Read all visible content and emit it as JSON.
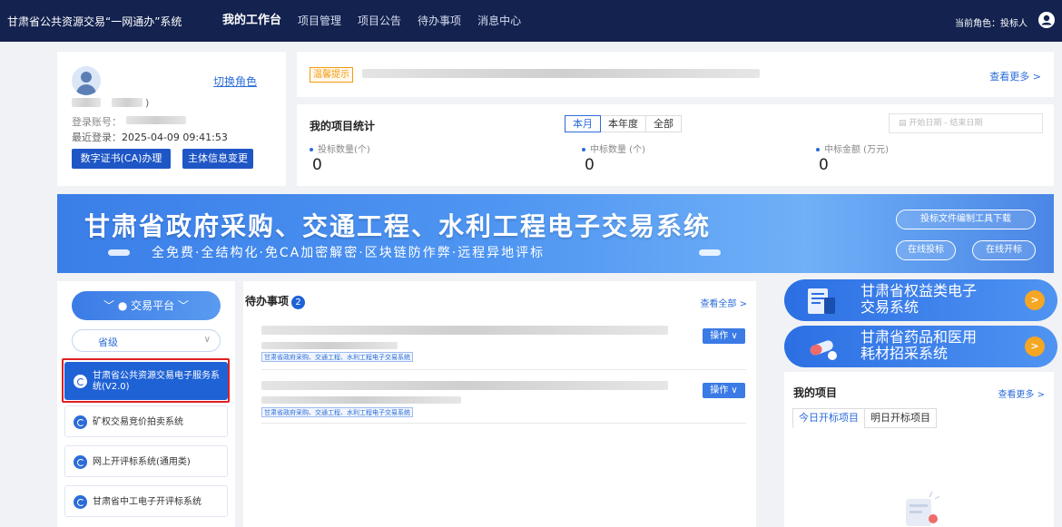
{
  "topbar": {
    "title": "甘肃省公共资源交易“一网通办”系统",
    "nav": [
      "我的工作台",
      "项目管理",
      "项目公告",
      "待办事项",
      "消息中心"
    ],
    "role": "当前角色：投标人"
  },
  "profile": {
    "switch_role": "切换角色",
    "name_suffix": ")",
    "login_account_label": "登录账号：",
    "last_login_label": "最近登录：",
    "last_login_value": "2025-04-09 09:41:53",
    "ca_button": "数字证书(CA)办理",
    "entity_button": "主体信息变更"
  },
  "notice": {
    "tag": "温馨提示",
    "more": "查看更多 >"
  },
  "stats": {
    "title": "我的项目统计",
    "tabs": [
      "本月",
      "本年度",
      "全部"
    ],
    "date_range": "开始日期 - 结束日期",
    "items": [
      {
        "label": "投标数量(个)",
        "value": "0"
      },
      {
        "label": "中标数量 (个)",
        "value": "0"
      },
      {
        "label": "中标金额 (万元)",
        "value": "0"
      }
    ]
  },
  "banner": {
    "title": "甘肃省政府采购、交通工程、水利工程电子交易系统",
    "subtitle": "全免费·全结构化·免CA加密解密·区块链防作弊·远程异地评标",
    "btn_download": "投标文件编制工具下载",
    "btn_bid": "在线投标",
    "btn_open": "在线开标"
  },
  "platform": {
    "title": "交易平台",
    "select_value": "省级",
    "systems": [
      "甘肃省公共资源交易电子服务系统(V2.0)",
      "矿权交易竞价拍卖系统",
      "网上开评标系统(通用类)",
      "甘肃省中工电子开评标系统"
    ]
  },
  "todo": {
    "title": "待办事项",
    "count": "2",
    "view_all": "查看全部 >",
    "items": [
      {
        "op": "操作 ∨",
        "tag": "甘肃省政府采购、交通工程、水利工程电子交易系统"
      },
      {
        "op": "操作 ∨",
        "tag": "甘肃省政府采购、交通工程、水利工程电子交易系统"
      }
    ]
  },
  "promos": [
    {
      "line1": "甘肃省权益类电子",
      "line2": "交易系统"
    },
    {
      "line1": "甘肃省药品和医用",
      "line2": "耗材招采系统"
    }
  ],
  "my_projects": {
    "title": "我的项目",
    "more": "查看更多 >",
    "tabs": [
      "今日开标项目",
      "明日开标项目"
    ]
  }
}
